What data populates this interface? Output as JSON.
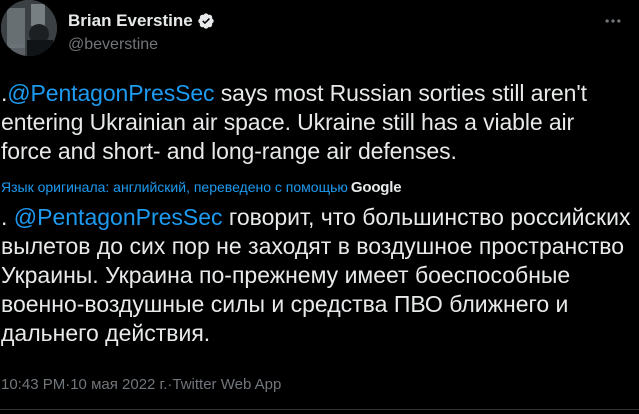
{
  "author": {
    "display_name": "Brian Everstine",
    "handle": "@beverstine",
    "verified": true
  },
  "tweet": {
    "text_prefix": ".",
    "mention": "@PentagonPresSec",
    "text_body": " says most Russian sorties still aren't entering Ukrainian air space. Ukraine still has a viable air force and short- and long-range air defenses."
  },
  "translation": {
    "notice": "Язык оригинала: английский, переведено с помощью",
    "provider": "Google",
    "text_prefix": ". ",
    "mention": "@PentagonPresSec",
    "text_body": " говорит, что большинство российских вылетов до сих пор не заходят в воздушное пространство Украины. Украина по-прежнему имеет боеспособные военно-воздушные силы и средства ПВО ближнего и дальнего действия."
  },
  "meta": {
    "time": "10:43 PM",
    "separator": " · ",
    "date": "10 мая 2022 г.",
    "source": "Twitter Web App"
  },
  "icons": {
    "verified": "verified-badge-icon",
    "more": "more-options-icon",
    "avatar": "profile-photo"
  },
  "colors": {
    "background": "#000000",
    "text": "#e7e9ea",
    "secondary": "#71767b",
    "accent": "#1d9bf0"
  }
}
